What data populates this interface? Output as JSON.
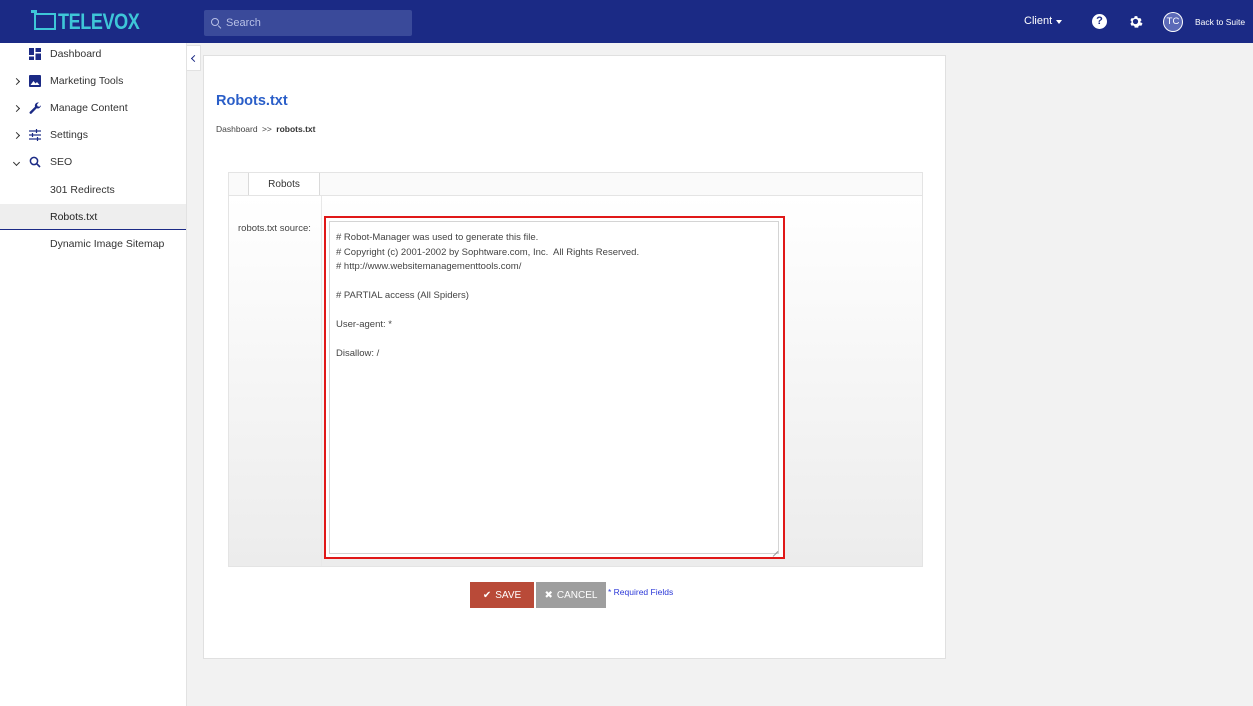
{
  "app": {
    "logo_text": "TELEVOX",
    "search_placeholder": "Search",
    "client_label": "Client",
    "help_glyph": "?",
    "avatar_initials": "TC",
    "back_to_suite": "Back to Suite",
    "brand_color": "#1b2a85",
    "logo_color": "#3ec6d8"
  },
  "sidebar": {
    "items": [
      {
        "label": "Dashboard",
        "icon": "dashboard-icon"
      },
      {
        "label": "Marketing Tools",
        "icon": "image-icon"
      },
      {
        "label": "Manage Content",
        "icon": "wrench-icon"
      },
      {
        "label": "Settings",
        "icon": "sliders-icon"
      },
      {
        "label": "SEO",
        "icon": "search-icon"
      }
    ],
    "seo_children": [
      {
        "label": "301 Redirects"
      },
      {
        "label": "Robots.txt",
        "active": true
      },
      {
        "label": "Dynamic Image Sitemap"
      }
    ]
  },
  "page": {
    "title": "Robots.txt",
    "breadcrumb": {
      "root": "Dashboard",
      "separator": ">>",
      "current": "robots.txt"
    },
    "tab_label": "Robots",
    "field_label": "robots.txt source:",
    "robots_source": "# Robot-Manager was used to generate this file.\n# Copyright (c) 2001-2002 by Sophtware.com, Inc.  All Rights Reserved.\n# http://www.websitemanagementtools.com/\n\n# PARTIAL access (All Spiders)\n\nUser-agent: *\n\nDisallow: /",
    "save_label": "SAVE",
    "cancel_label": "CANCEL",
    "required_note": "* Required Fields",
    "save_color": "#b94a38",
    "highlight_color": "#e01818"
  }
}
